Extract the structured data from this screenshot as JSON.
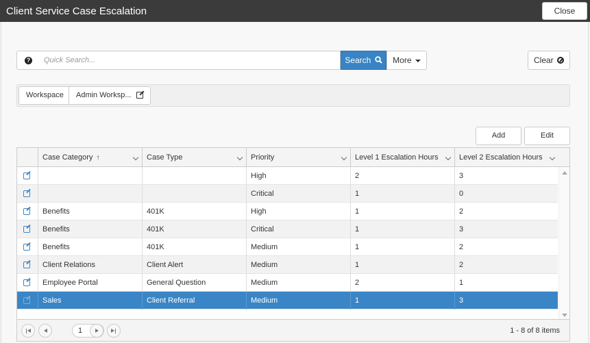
{
  "window": {
    "title": "Client Service Case Escalation",
    "close_label": "Close"
  },
  "search": {
    "placeholder": "Quick Search...",
    "button_label": "Search",
    "more_label": "More",
    "clear_label": "Clear"
  },
  "workspaces": {
    "tab1": "Workspace",
    "tab2": "Admin Worksp..."
  },
  "actions": {
    "add_label": "Add",
    "edit_label": "Edit"
  },
  "grid": {
    "columns": [
      "Case Category",
      "Case Type",
      "Priority",
      "Level 1 Escalation Hours",
      "Level 2 Escalation Hours"
    ],
    "sort_indicator": "↑",
    "rows": [
      {
        "category": "",
        "type": "",
        "priority": "High",
        "l1": "2",
        "l2": "3"
      },
      {
        "category": "",
        "type": "",
        "priority": "Critical",
        "l1": "1",
        "l2": "0"
      },
      {
        "category": "Benefits",
        "type": "401K",
        "priority": "High",
        "l1": "1",
        "l2": "2"
      },
      {
        "category": "Benefits",
        "type": "401K",
        "priority": "Critical",
        "l1": "1",
        "l2": "3"
      },
      {
        "category": "Benefits",
        "type": "401K",
        "priority": "Medium",
        "l1": "1",
        "l2": "2"
      },
      {
        "category": "Client Relations",
        "type": "Client Alert",
        "priority": "Medium",
        "l1": "1",
        "l2": "2"
      },
      {
        "category": "Employee Portal",
        "type": "General Question",
        "priority": "Medium",
        "l1": "2",
        "l2": "1"
      },
      {
        "category": "Sales",
        "type": "Client Referral",
        "priority": "Medium",
        "l1": "1",
        "l2": "3"
      }
    ],
    "selected_row": 7
  },
  "pager": {
    "page": "1",
    "info": "1 - 8 of 8 items"
  },
  "colors": {
    "accent": "#3a85c5",
    "titlebar": "#3b3b3b"
  }
}
